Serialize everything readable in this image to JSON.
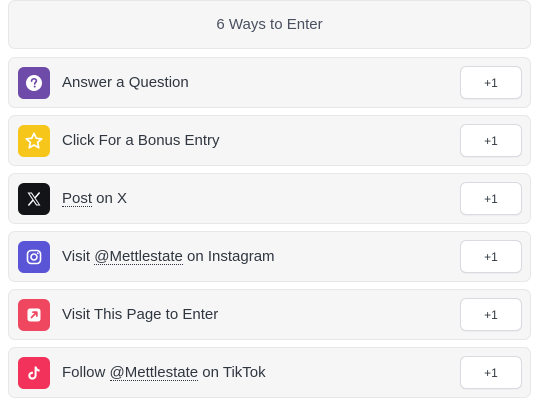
{
  "header": {
    "title": "6 Ways to Enter"
  },
  "entries": [
    {
      "icon": "question-icon",
      "color": "#6e4ba8",
      "label": "Answer a Question",
      "points": "+1"
    },
    {
      "icon": "star-icon",
      "color": "#f7c61a",
      "label": "Click For a Bonus Entry",
      "points": "+1"
    },
    {
      "icon": "x-logo-icon",
      "color": "#121418",
      "pre": "",
      "handle": "Post",
      "post": " on X",
      "points": "+1"
    },
    {
      "icon": "instagram-icon",
      "color": "#5a55d6",
      "pre": "Visit ",
      "handle": "@Mettlestate",
      "post": " on Instagram",
      "points": "+1"
    },
    {
      "icon": "external-link-icon",
      "color": "#ef4760",
      "label": "Visit This Page to Enter",
      "points": "+1"
    },
    {
      "icon": "tiktok-icon",
      "color": "#f2325a",
      "pre": "Follow ",
      "handle": "@Mettlestate",
      "post": " on TikTok",
      "points": "+1"
    }
  ]
}
